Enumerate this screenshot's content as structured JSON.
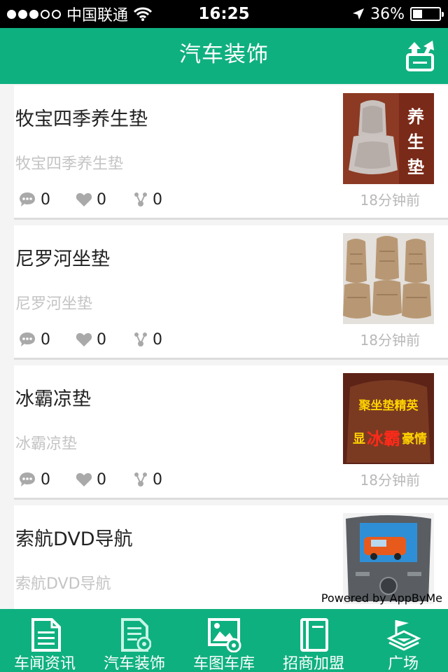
{
  "status_bar": {
    "carrier": "中国联通",
    "time": "16:25",
    "battery": "36%",
    "battery_level": 0.36,
    "signal_bars": 3
  },
  "header": {
    "title": "汽车装饰",
    "share_icon": "share-icon"
  },
  "items": [
    {
      "title": "牧宝四季养生垫",
      "subtitle": "牧宝四季养生垫",
      "comments": "0",
      "likes": "0",
      "shares": "0",
      "time": "18分钟前",
      "thumb_text": "养生垫"
    },
    {
      "title": "尼罗河坐垫",
      "subtitle": "尼罗河坐垫",
      "comments": "0",
      "likes": "0",
      "shares": "0",
      "time": "18分钟前"
    },
    {
      "title": "冰霸凉垫",
      "subtitle": "冰霸凉垫",
      "comments": "0",
      "likes": "0",
      "shares": "0",
      "time": "18分钟前",
      "thumb_text_1": "聚坐垫精英",
      "thumb_text_2": "显",
      "thumb_text_3": "冰霸",
      "thumb_text_4": "豪情"
    },
    {
      "title": "索航DVD导航",
      "subtitle": "索航DVD导航"
    }
  ],
  "powered_by": "Powered by AppByMe",
  "tabs": [
    {
      "label": "车闻资讯",
      "icon": "news-icon"
    },
    {
      "label": "汽车装饰",
      "icon": "decor-icon"
    },
    {
      "label": "车图车库",
      "icon": "gallery-icon"
    },
    {
      "label": "招商加盟",
      "icon": "book-icon"
    },
    {
      "label": "广场",
      "icon": "plaza-icon"
    }
  ],
  "colors": {
    "accent": "#0fb07f",
    "title_text": "#222222",
    "muted_text": "#c4c4c4"
  }
}
